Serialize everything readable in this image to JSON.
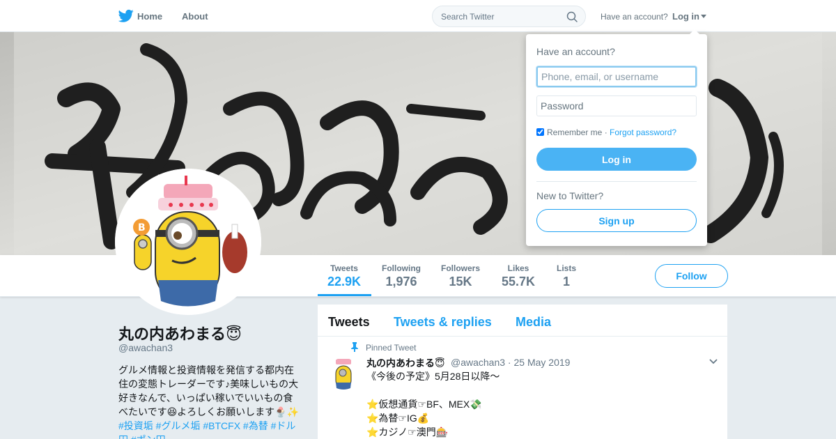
{
  "colors": {
    "accent": "#1da1f2",
    "login_button": "#4ab3f4",
    "text_secondary": "#657786",
    "page_bg": "#e6ecf0"
  },
  "topbar": {
    "logo_icon": "twitter-bird-icon",
    "home_label": "Home",
    "about_label": "About",
    "search": {
      "placeholder": "Search Twitter",
      "value": "",
      "icon": "search-icon"
    },
    "have_account_text": "Have an account?",
    "login_label": "Log in"
  },
  "profile_nav": {
    "stats": [
      {
        "label": "Tweets",
        "value": "22.9K",
        "active": true
      },
      {
        "label": "Following",
        "value": "1,976"
      },
      {
        "label": "Followers",
        "value": "15K"
      },
      {
        "label": "Likes",
        "value": "55.7K"
      },
      {
        "label": "Lists",
        "value": "1"
      }
    ],
    "follow_label": "Follow"
  },
  "profile": {
    "name": "丸の内あわまる😇",
    "handle": "@awachan3",
    "bio_text": "グルメ情報と投資情報を発信する都内在住の変態トレーダーです♪美味しいもの大好きなんで、いっぱい稼いでいいもの食べたいです😆よろしくお願いします🍨✨ ",
    "bio_tags": "#投資垢 #グルメ垢 #BTCFX #為替 #ドル円 #ポン円"
  },
  "timeline": {
    "tabs": [
      {
        "label": "Tweets",
        "active": true
      },
      {
        "label": "Tweets & replies"
      },
      {
        "label": "Media"
      }
    ],
    "pinned_tweet": {
      "pinned_label": "Pinned Tweet",
      "author_name": "丸の内あわまる😇",
      "author_meta": "@awachan3 · 25 May 2019",
      "text": "《今後の予定》5月28日以降〜\n\n⭐️仮想通貨☞BF、MEX💸\n⭐️為替☞IG💰\n⭐️カジノ☞澳門🎰"
    }
  },
  "login_dropdown": {
    "title": "Have an account?",
    "username_placeholder": "Phone, email, or username",
    "password_placeholder": "Password",
    "remember_label": "Remember me",
    "remember_checked": true,
    "separator": " · ",
    "forgot_label": "Forgot password?",
    "login_button": "Log in",
    "new_text": "New to Twitter?",
    "signup_button": "Sign up"
  }
}
